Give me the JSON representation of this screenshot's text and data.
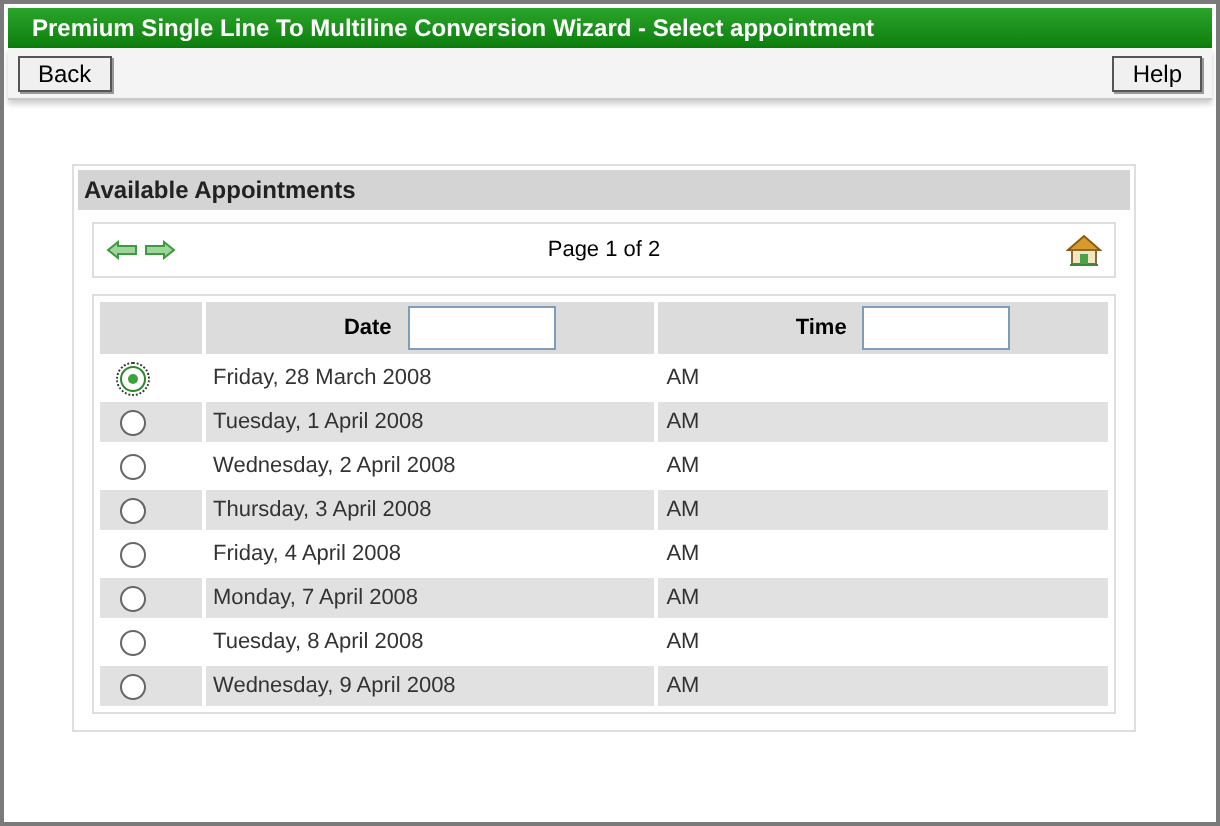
{
  "window": {
    "title": "Premium Single Line To Multiline Conversion Wizard - Select appointment"
  },
  "toolbar": {
    "buttons": [
      "Back",
      "Help"
    ]
  },
  "panel": {
    "title": "Available Appointments",
    "pager": "Page 1 of 2"
  },
  "table": {
    "columns": [
      "Date",
      "Time"
    ],
    "rows": [
      {
        "date": "Friday, 28 March 2008",
        "time": "AM",
        "selected": true
      },
      {
        "date": "Tuesday, 1 April 2008",
        "time": "AM",
        "selected": false
      },
      {
        "date": "Wednesday, 2 April 2008",
        "time": "AM",
        "selected": false
      },
      {
        "date": "Thursday, 3 April 2008",
        "time": "AM",
        "selected": false
      },
      {
        "date": "Friday, 4 April 2008",
        "time": "AM",
        "selected": false
      },
      {
        "date": "Monday, 7 April 2008",
        "time": "AM",
        "selected": false
      },
      {
        "date": "Tuesday, 8 April 2008",
        "time": "AM",
        "selected": false
      },
      {
        "date": "Wednesday, 9 April 2008",
        "time": "AM",
        "selected": false
      }
    ]
  }
}
